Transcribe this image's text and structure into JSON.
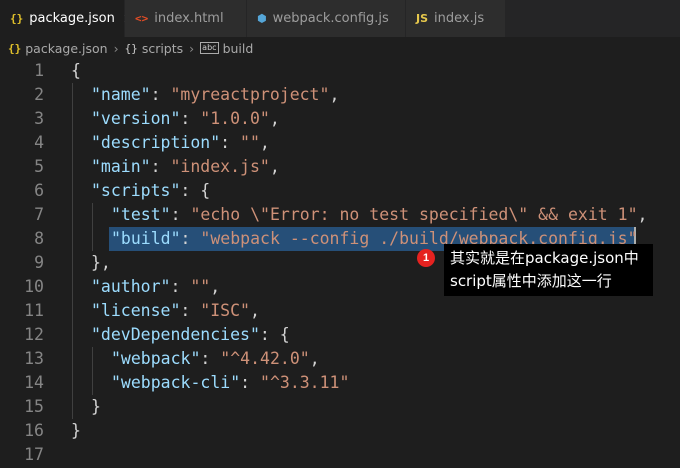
{
  "tabs": [
    {
      "icon": "{}",
      "label": "package.json",
      "close": "×"
    },
    {
      "icon": "<>",
      "label": "index.html"
    },
    {
      "icon": "⬢",
      "label": "webpack.config.js"
    },
    {
      "icon": "JS",
      "label": "index.js"
    }
  ],
  "breadcrumb": {
    "file_icon": "{}",
    "file": "package.json",
    "sep1": "›",
    "obj_icon": "{}",
    "section": "scripts",
    "sep2": "›",
    "str_icon": "abc",
    "item": "build"
  },
  "editor": {
    "lines": [
      {
        "n": "1",
        "t": [
          [
            "p",
            "{"
          ]
        ]
      },
      {
        "n": "2",
        "t": [
          [
            "k",
            "\"name\""
          ],
          [
            "p",
            ": "
          ],
          [
            "s",
            "\"myreactproject\""
          ],
          [
            "p",
            ","
          ]
        ]
      },
      {
        "n": "3",
        "t": [
          [
            "k",
            "\"version\""
          ],
          [
            "p",
            ": "
          ],
          [
            "s",
            "\"1.0.0\""
          ],
          [
            "p",
            ","
          ]
        ]
      },
      {
        "n": "4",
        "t": [
          [
            "k",
            "\"description\""
          ],
          [
            "p",
            ": "
          ],
          [
            "s",
            "\"\""
          ],
          [
            "p",
            ","
          ]
        ]
      },
      {
        "n": "5",
        "t": [
          [
            "k",
            "\"main\""
          ],
          [
            "p",
            ": "
          ],
          [
            "s",
            "\"index.js\""
          ],
          [
            "p",
            ","
          ]
        ]
      },
      {
        "n": "6",
        "t": [
          [
            "k",
            "\"scripts\""
          ],
          [
            "p",
            ": {"
          ]
        ]
      },
      {
        "n": "7",
        "t": [
          [
            "k",
            "\"test\""
          ],
          [
            "p",
            ": "
          ],
          [
            "s",
            "\"echo \\\"Error: no test specified\\\" && exit 1\""
          ],
          [
            "p",
            ","
          ]
        ]
      },
      {
        "n": "8",
        "t": [
          [
            "k",
            "\"build\""
          ],
          [
            "p",
            ": "
          ],
          [
            "s",
            "\"webpack --config ./build/webpack.config.js\""
          ]
        ]
      },
      {
        "n": "9",
        "t": [
          [
            "p",
            "},"
          ]
        ]
      },
      {
        "n": "10",
        "t": [
          [
            "k",
            "\"author\""
          ],
          [
            "p",
            ": "
          ],
          [
            "s",
            "\"\""
          ],
          [
            "p",
            ","
          ]
        ]
      },
      {
        "n": "11",
        "t": [
          [
            "k",
            "\"license\""
          ],
          [
            "p",
            ": "
          ],
          [
            "s",
            "\"ISC\""
          ],
          [
            "p",
            ","
          ]
        ]
      },
      {
        "n": "12",
        "t": [
          [
            "k",
            "\"devDependencies\""
          ],
          [
            "p",
            ": {"
          ]
        ]
      },
      {
        "n": "13",
        "t": [
          [
            "k",
            "\"webpack\""
          ],
          [
            "p",
            ": "
          ],
          [
            "s",
            "\"^4.42.0\""
          ],
          [
            "p",
            ","
          ]
        ]
      },
      {
        "n": "14",
        "t": [
          [
            "k",
            "\"webpack-cli\""
          ],
          [
            "p",
            ": "
          ],
          [
            "s",
            "\"^3.3.11\""
          ]
        ]
      },
      {
        "n": "15",
        "t": [
          [
            "p",
            "}"
          ]
        ]
      },
      {
        "n": "16",
        "t": [
          [
            "p",
            "}"
          ]
        ]
      },
      {
        "n": "17",
        "t": []
      }
    ]
  },
  "annotation": {
    "badge": "1",
    "line1": "其实就是在package.json中",
    "line2": "script属性中添加这一行"
  },
  "colors": {
    "key": "#9cdcfe",
    "string": "#ce9178",
    "punct": "#d4d4d4",
    "selection": "#264f78",
    "badge": "#e52220"
  }
}
